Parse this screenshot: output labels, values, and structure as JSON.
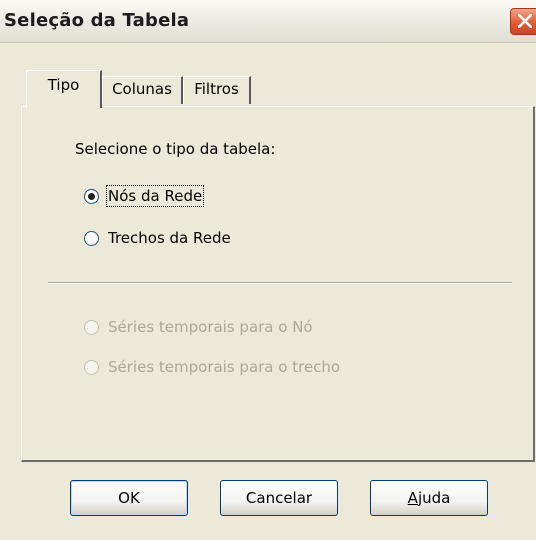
{
  "window": {
    "title": "Seleção da Tabela"
  },
  "tabs": [
    {
      "label": "Tipo",
      "active": true
    },
    {
      "label": "Colunas",
      "active": false
    },
    {
      "label": "Filtros",
      "active": false
    }
  ],
  "panel": {
    "prompt": "Selecione o tipo da tabela:",
    "options": [
      {
        "label": "Nós da Rede",
        "checked": true,
        "enabled": true
      },
      {
        "label": "Trechos da Rede",
        "checked": false,
        "enabled": true
      },
      {
        "label": "Séries temporais para o Nó",
        "checked": false,
        "enabled": false
      },
      {
        "label": "Séries temporais para o trecho",
        "checked": false,
        "enabled": false
      }
    ]
  },
  "buttons": {
    "ok": "OK",
    "cancel": "Cancelar",
    "help_key": "A",
    "help_rest": "juda"
  },
  "icons": {
    "close": "close-icon"
  },
  "colors": {
    "dialog_bg": "#ece9d8",
    "close_button": "#e2613e",
    "disabled_text": "#aca899",
    "button_border": "#003c74"
  }
}
